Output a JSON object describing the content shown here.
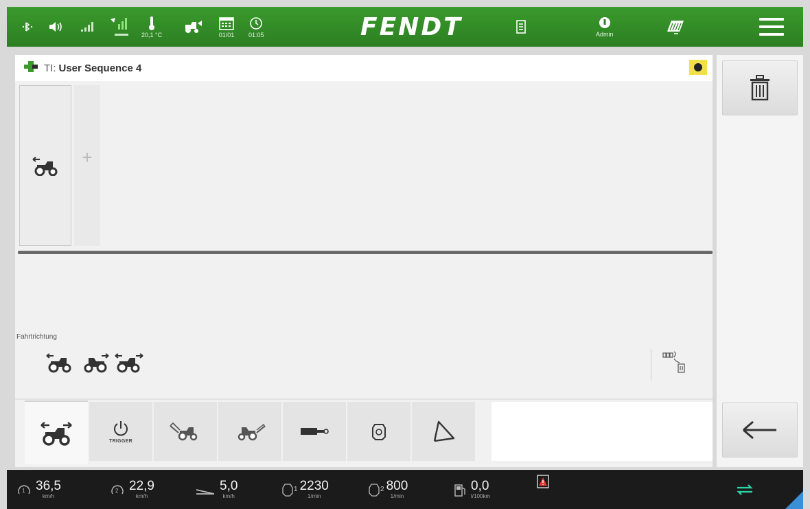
{
  "topbar": {
    "temperature": "20,1 °C",
    "date": "01/01",
    "time": "01:05",
    "brand": "FENDT",
    "user": "Admin",
    "icons": [
      "bluetooth-icon",
      "volume-icon",
      "signal-bars-icon",
      "gps-signal-icon",
      "thermometer-icon",
      "tractor-loader-icon",
      "calendar-icon",
      "clock-icon",
      "document-icon",
      "user-icon",
      "field-icon",
      "menu-icon"
    ]
  },
  "main": {
    "title_prefix": "TI:",
    "title": "User Sequence 4",
    "add_symbol": "+",
    "direction_label": "Fahrtrichtung",
    "tabs": [
      {
        "name": "direction",
        "label": ""
      },
      {
        "name": "trigger",
        "label": "TRIGGER"
      },
      {
        "name": "front-implement",
        "label": ""
      },
      {
        "name": "rear-implement",
        "label": ""
      },
      {
        "name": "hydraulic-valve",
        "label": ""
      },
      {
        "name": "engine",
        "label": ""
      },
      {
        "name": "steering",
        "label": ""
      }
    ]
  },
  "bottombar": {
    "speed1": {
      "value": "36,5",
      "unit": "km/h",
      "index": "1"
    },
    "speed2": {
      "value": "22,9",
      "unit": "km/h",
      "index": "2"
    },
    "slip_speed": {
      "value": "5,0",
      "unit": "km/h"
    },
    "rpm1": {
      "value": "2230",
      "unit": "1/min",
      "index": "1"
    },
    "rpm2": {
      "value": "800",
      "unit": "1/min",
      "index": "2"
    },
    "fuel": {
      "value": "0,0",
      "unit": "l/100km"
    }
  },
  "colors": {
    "brand_green": "#2f8a25",
    "status_yellow": "#f2e04b",
    "bottom_accent": "#3a8fd8",
    "sync_icon": "#2bd4a6"
  }
}
